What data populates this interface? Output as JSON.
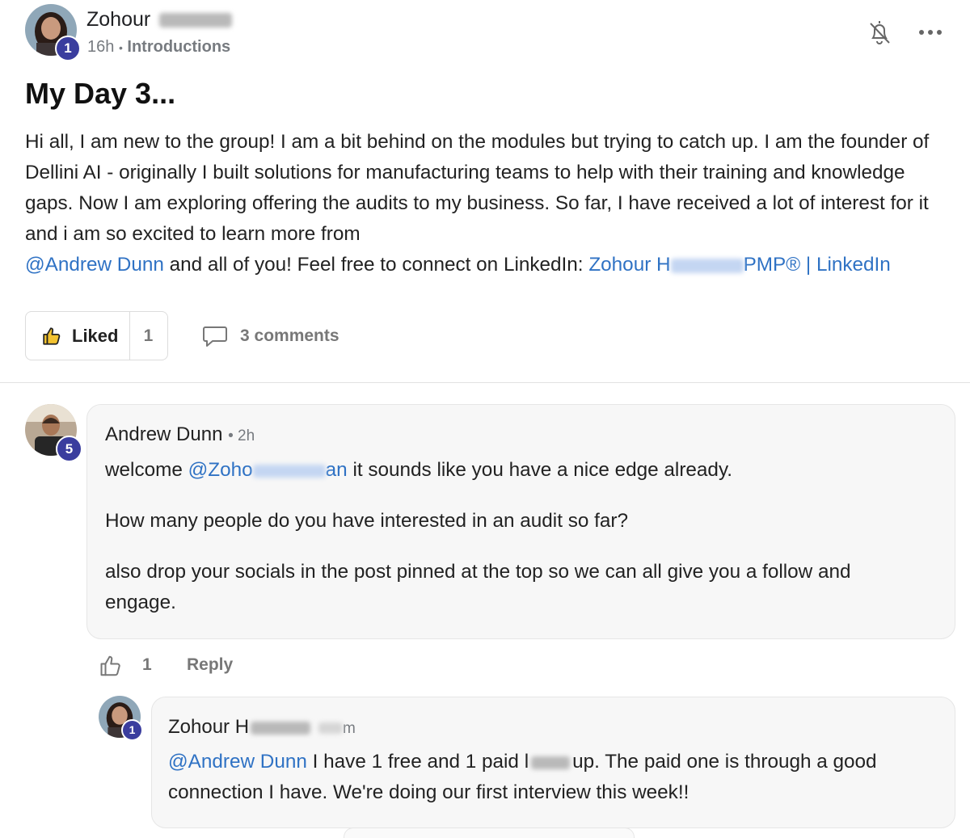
{
  "post": {
    "author_first": "Zohour",
    "author_level": "1",
    "time": "16h",
    "separator": "•",
    "category": "Introductions",
    "title": "My Day 3...",
    "body_p1": "Hi all, I am new to the group! I am a bit behind on the modules but trying to catch up. I am the founder of Dellini AI - originally I built solutions for manufacturing teams to help with their training and knowledge gaps. Now I am exploring offering the audits to my business. So far, I have received a lot of interest for it and i am so excited to learn more from",
    "mention": "@Andrew Dunn",
    "body_p2": " and all of you! Feel free to connect on LinkedIn: ",
    "linkedin_prefix": "Zohour H",
    "linkedin_suffix": "PMP® | LinkedIn",
    "like_label": "Liked",
    "like_count": "1",
    "comments_label": "3 comments"
  },
  "comments": [
    {
      "author": "Andrew Dunn",
      "level": "5",
      "time": "2h",
      "line1_prefix": "welcome ",
      "line1_mention_a": "@Zoho",
      "line1_mention_b": "an",
      "line1_rest": " it sounds like you have a nice edge already.",
      "line2": "How many people do you have interested in an audit so far?",
      "line3": "also drop your socials in the post pinned at the top so we can all give you a follow and engage.",
      "like_count": "1",
      "reply_label": "Reply"
    },
    {
      "author_prefix": "Zohour H",
      "time_tail": "m",
      "level": "1",
      "mention": "@Andrew Dunn",
      "text_a": " I have 1 free and 1 paid l",
      "text_b": "up. The paid one is through a good connection I have. We're doing our first interview this week!!"
    }
  ],
  "icons": {
    "bell": "bell-off-icon",
    "more": "more-horizontal-icon",
    "thumb": "thumbs-up-icon",
    "comment": "comment-bubble-icon"
  },
  "colors": {
    "badge": "#3a3d9e",
    "link": "#2f72c4",
    "muted": "#777b80",
    "liked_thumb": "#f2c230"
  }
}
